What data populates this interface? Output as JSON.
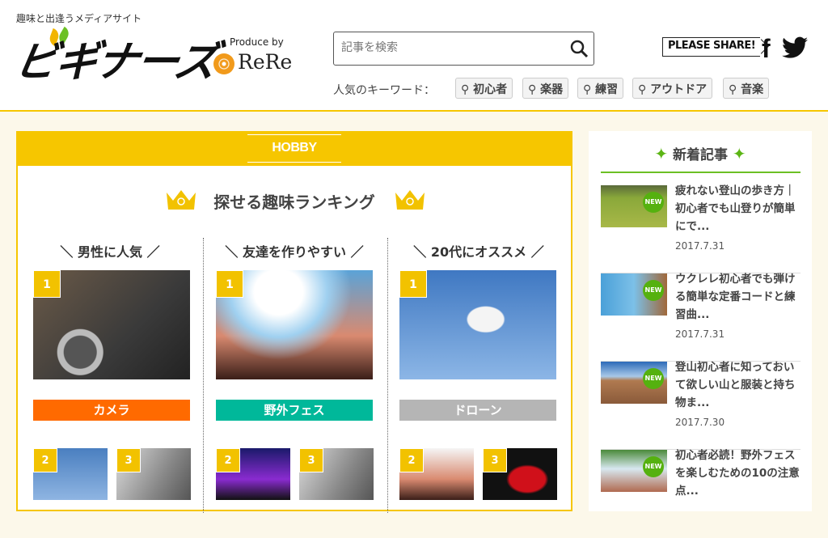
{
  "header": {
    "tagline": "趣味と出逢うメディアサイト",
    "logo": "ビギナーズ",
    "produce_by": "Produce by",
    "partner": "ReRe",
    "search_placeholder": "記事を検索",
    "keywords_label": "人気のキーワード：",
    "keywords": [
      "初心者",
      "楽器",
      "練習",
      "アウトドア",
      "音楽"
    ],
    "share_label": "PLEASE SHARE!"
  },
  "ranking": {
    "band_title": "HOBBY RANKING",
    "title": "探せる趣味ランキング",
    "columns": [
      {
        "heading": "＼ 男性に人気 ／",
        "top": "カメラ",
        "color": "#ff6a00",
        "ranks": [
          "1",
          "2",
          "3"
        ]
      },
      {
        "heading": "＼ 友達を作りやすい ／",
        "top": "野外フェス",
        "color": "#00b89a",
        "ranks": [
          "1",
          "2",
          "3"
        ]
      },
      {
        "heading": "＼ 20代にオススメ ／",
        "top": "ドローン",
        "color": "#b5b5b5",
        "ranks": [
          "1",
          "2",
          "3"
        ]
      }
    ]
  },
  "sidebar": {
    "title": "新着記事",
    "star": "✦",
    "new_badge": "NEW",
    "items": [
      {
        "title": "疲れない登山の歩き方｜初心者でも山登りが簡単にで...",
        "date": "2017.7.31"
      },
      {
        "title": "ウクレレ初心者でも弾ける簡単な定番コードと練習曲...",
        "date": "2017.7.31"
      },
      {
        "title": "登山初心者に知っておいて欲しい山と服装と持ち物ま...",
        "date": "2017.7.30"
      },
      {
        "title": "初心者必読！野外フェスを楽しむための10の注意点...",
        "date": ""
      }
    ]
  }
}
